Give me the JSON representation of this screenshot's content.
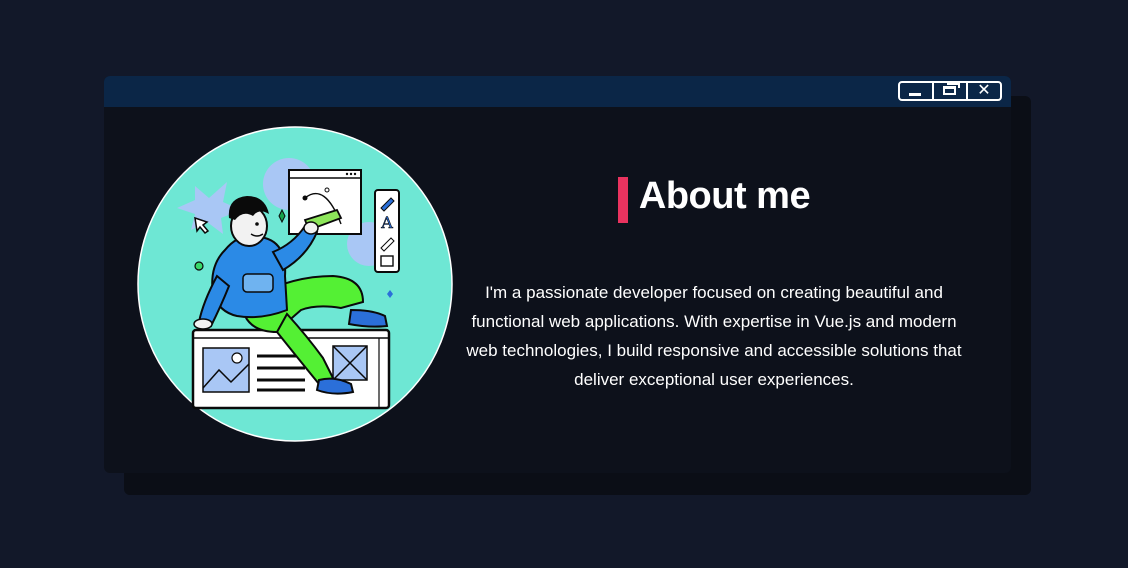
{
  "window": {
    "controls": {
      "minimize_icon": "minimize-icon",
      "maximize_icon": "maximize-icon",
      "close_icon": "close-icon",
      "close_glyph": "✕"
    }
  },
  "about": {
    "title": "About me",
    "description": "I'm a passionate developer focused on creating beautiful and functional web applications. With expertise in Vue.js and modern web technologies, I build responsive and accessible solutions that deliver exceptional user experiences."
  },
  "colors": {
    "page_background": "#121829",
    "window_background": "#0d111b",
    "titlebar": "#0b2647",
    "accent": "#e9335f",
    "illustration_circle": "#6ee7d4"
  }
}
